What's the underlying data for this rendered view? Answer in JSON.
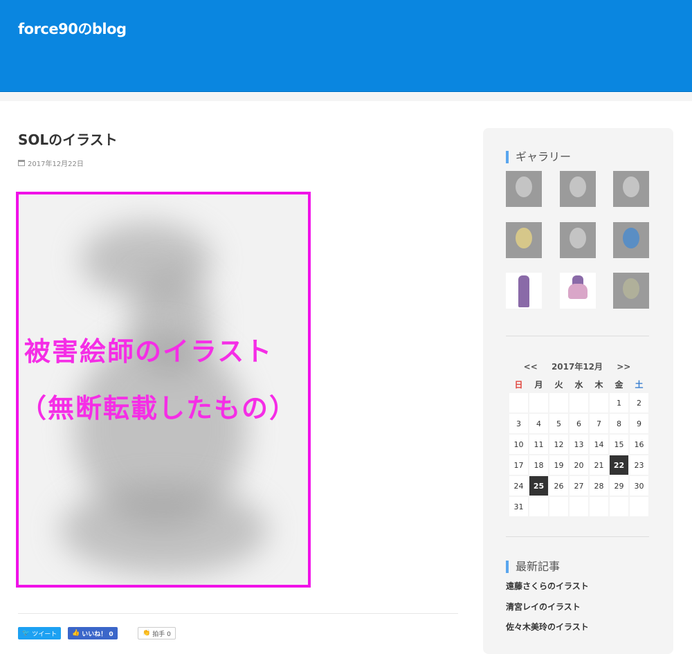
{
  "site": {
    "title": "force90のblog"
  },
  "post": {
    "title": "SOLのイラスト",
    "date": "2017年12月22日",
    "overlay_line1": "被害絵師のイラスト",
    "overlay_line2": "（無断転載したもの）"
  },
  "share": {
    "tweet": "ツイート",
    "like": "いいね！ 0",
    "clap": "拍手 0"
  },
  "sidebar": {
    "gallery_title": "ギャラリー",
    "calendar": {
      "prev": "<<",
      "month": "2017年12月",
      "next": ">>",
      "weekdays": [
        "日",
        "月",
        "火",
        "水",
        "木",
        "金",
        "土"
      ],
      "weeks": [
        [
          "",
          "",
          "",
          "",
          "",
          "1",
          "2"
        ],
        [
          "3",
          "4",
          "5",
          "6",
          "7",
          "8",
          "9"
        ],
        [
          "10",
          "11",
          "12",
          "13",
          "14",
          "15",
          "16"
        ],
        [
          "17",
          "18",
          "19",
          "20",
          "21",
          "22",
          "23"
        ],
        [
          "24",
          "25",
          "26",
          "27",
          "28",
          "29",
          "30"
        ],
        [
          "31",
          "",
          "",
          "",
          "",
          "",
          ""
        ]
      ],
      "highlighted": [
        "22",
        "25"
      ]
    },
    "recent_title": "最新記事",
    "recent": [
      "遠藤さくらのイラスト",
      "清宮レイのイラスト",
      "佐々木美玲のイラスト"
    ]
  },
  "colors": {
    "header": "#0a86e0",
    "overlay_border": "#f011e8",
    "overlay_text": "#f52de6",
    "widget_accent": "#5aa6ee"
  }
}
